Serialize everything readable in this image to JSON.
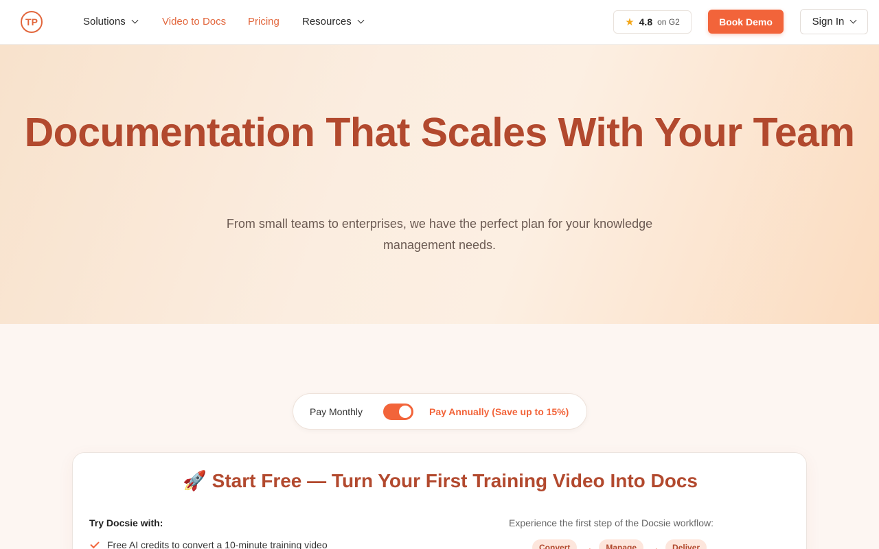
{
  "header": {
    "logo_text": "TP",
    "nav": [
      {
        "label": "Solutions",
        "has_dropdown": true
      },
      {
        "label": "Video to Docs",
        "has_dropdown": false
      },
      {
        "label": "Pricing",
        "has_dropdown": false
      },
      {
        "label": "Resources",
        "has_dropdown": true
      }
    ],
    "rating": {
      "value": "4.8",
      "suffix": "on G2",
      "icon": "star-icon"
    },
    "book_demo_label": "Book Demo",
    "sign_in_label": "Sign In"
  },
  "hero": {
    "title": "Documentation That Scales With Your Team",
    "subtitle": "From small teams to enterprises, we have the perfect plan for your knowledge management needs."
  },
  "billing": {
    "monthly_label": "Pay Monthly",
    "annually_label": "Pay Annually (Save up to 15%)",
    "annual_selected": true
  },
  "free_card": {
    "title": "🚀 Start Free — Turn Your First Training Video Into Docs",
    "try_label": "Try Docsie with:",
    "features": [
      "Free AI credits to convert a 10-minute training video"
    ],
    "workflow_label": "Experience the first step of the Docsie workflow:",
    "steps": [
      "Convert",
      "Manage",
      "Deliver"
    ]
  },
  "colors": {
    "accent": "#f2643a",
    "heading": "#b2492e",
    "active_nav": "#e2663c"
  }
}
